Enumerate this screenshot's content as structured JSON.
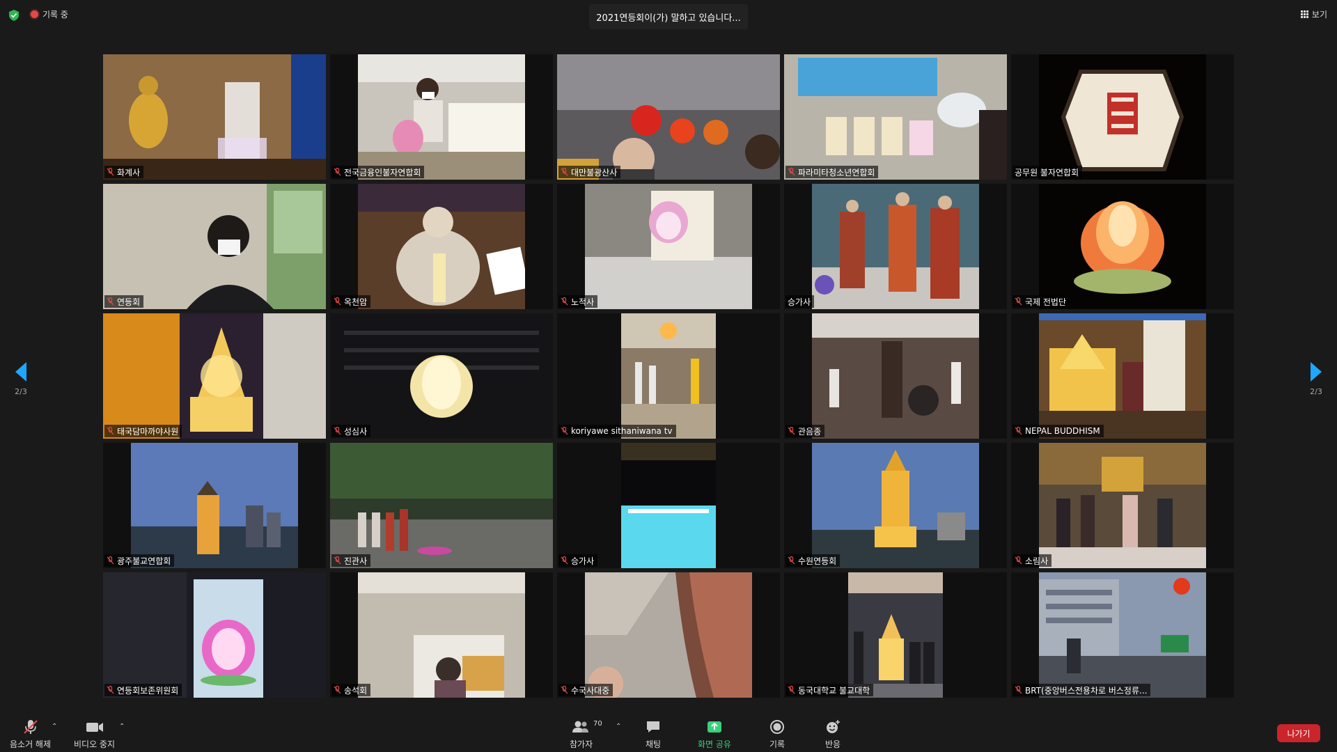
{
  "topbar": {
    "recording_label": "기록 중",
    "speaker_text": "2021연등회이(가) 말하고 있습니다...",
    "view_label": "보기"
  },
  "pager": {
    "left": "2/3",
    "right": "2/3"
  },
  "participants": [
    {
      "name": "화계사"
    },
    {
      "name": "전국금융인불자연합회"
    },
    {
      "name": "대만불광산사"
    },
    {
      "name": "파라미타청소년연합회"
    },
    {
      "name": "공무원 불자연합회"
    },
    {
      "name": "연등회"
    },
    {
      "name": "옥천암"
    },
    {
      "name": "노적사"
    },
    {
      "name": "승가사"
    },
    {
      "name": "국제 전법단"
    },
    {
      "name": "태국담마까야사원"
    },
    {
      "name": "성심사"
    },
    {
      "name": "koriyawe sithaniwana tv"
    },
    {
      "name": "관음종"
    },
    {
      "name": "NEPAL BUDDHISM"
    },
    {
      "name": "광주불교연합회"
    },
    {
      "name": "진관사"
    },
    {
      "name": "승가사"
    },
    {
      "name": "수원연등회"
    },
    {
      "name": "소림사"
    },
    {
      "name": "연등회보존위원회"
    },
    {
      "name": "송석회"
    },
    {
      "name": "수국사대중"
    },
    {
      "name": "동국대학교 불교대학"
    },
    {
      "name": "BRT(중앙버스전용차로 버스정류..."
    }
  ],
  "toolbar": {
    "mute_label": "음소거 해제",
    "video_label": "비디오 중지",
    "participants_label": "참가자",
    "participants_count": "70",
    "chat_label": "채팅",
    "share_label": "화면 공유",
    "record_label": "기록",
    "reactions_label": "반응",
    "exit_label": "나가기"
  },
  "colors": {
    "accent_arrow": "#1ea7ff",
    "share_green": "#3ad17a",
    "exit_red": "#c9252b",
    "record_red": "#e04a4a"
  }
}
